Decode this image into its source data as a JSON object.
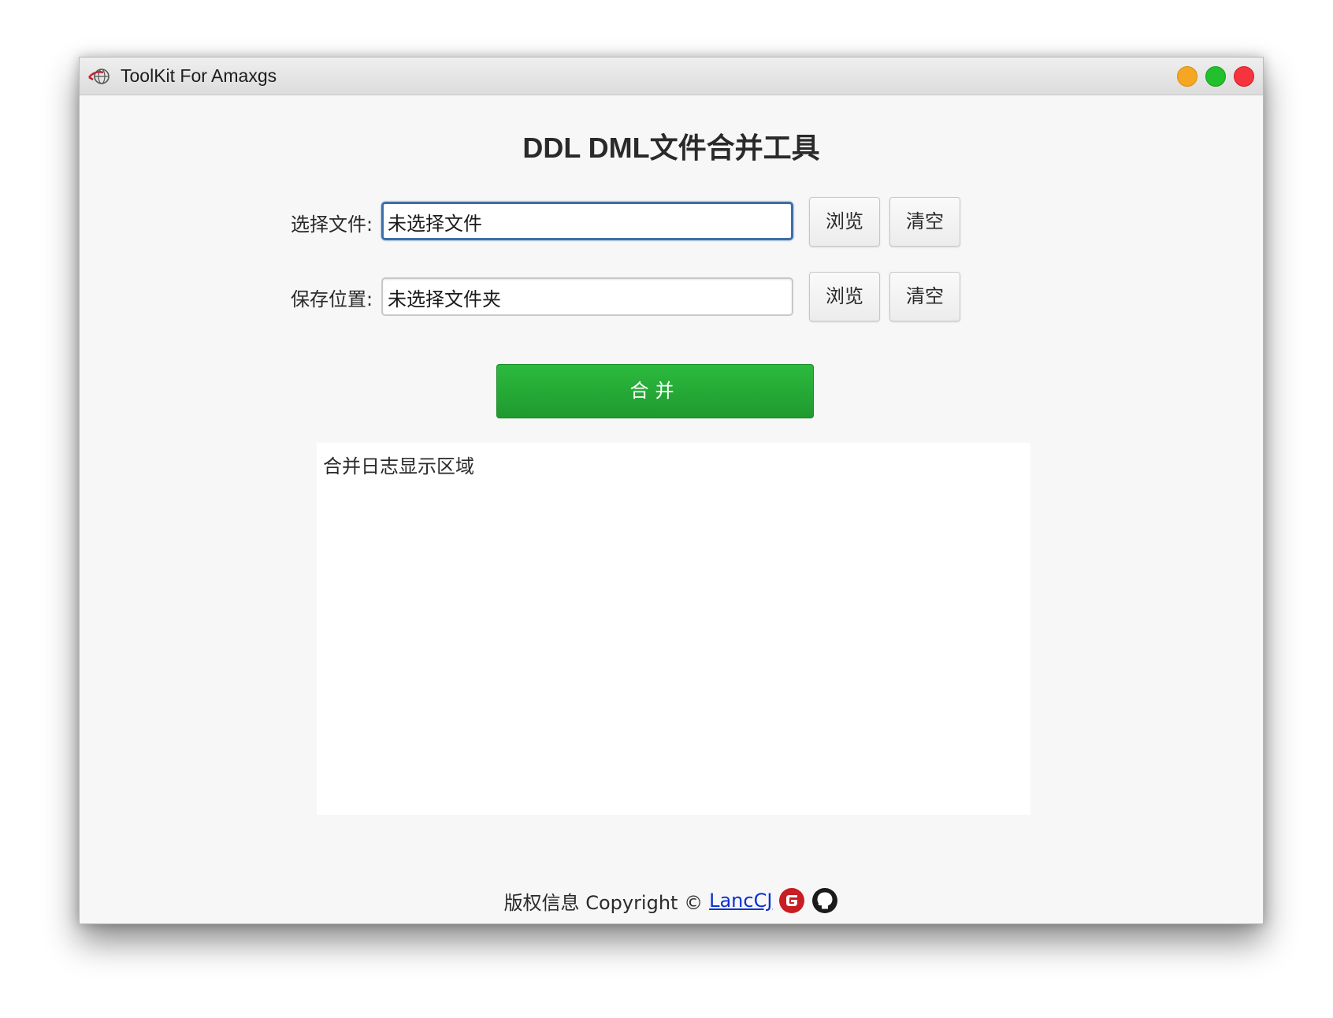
{
  "window": {
    "title": "ToolKit For Amaxgs"
  },
  "main": {
    "heading": "DDL DML文件合并工具",
    "file_row": {
      "label": "选择文件:",
      "value": "未选择文件",
      "browse_label": "浏览",
      "clear_label": "清空"
    },
    "save_row": {
      "label": "保存位置:",
      "value": "未选择文件夹",
      "browse_label": "浏览",
      "clear_label": "清空"
    },
    "merge_label": "合并",
    "log_placeholder": "合并日志显示区域"
  },
  "footer": {
    "copyright": "版权信息 Copyright ©",
    "author_link": "LancCJ",
    "icons": [
      "gitee-icon",
      "github-icon"
    ]
  },
  "colors": {
    "merge_button": "#22aa35",
    "link": "#0b2fd1",
    "focus_border": "#3f6ea8",
    "window_min": "#f5a623",
    "window_max": "#22c02d",
    "window_close": "#f5343d"
  }
}
